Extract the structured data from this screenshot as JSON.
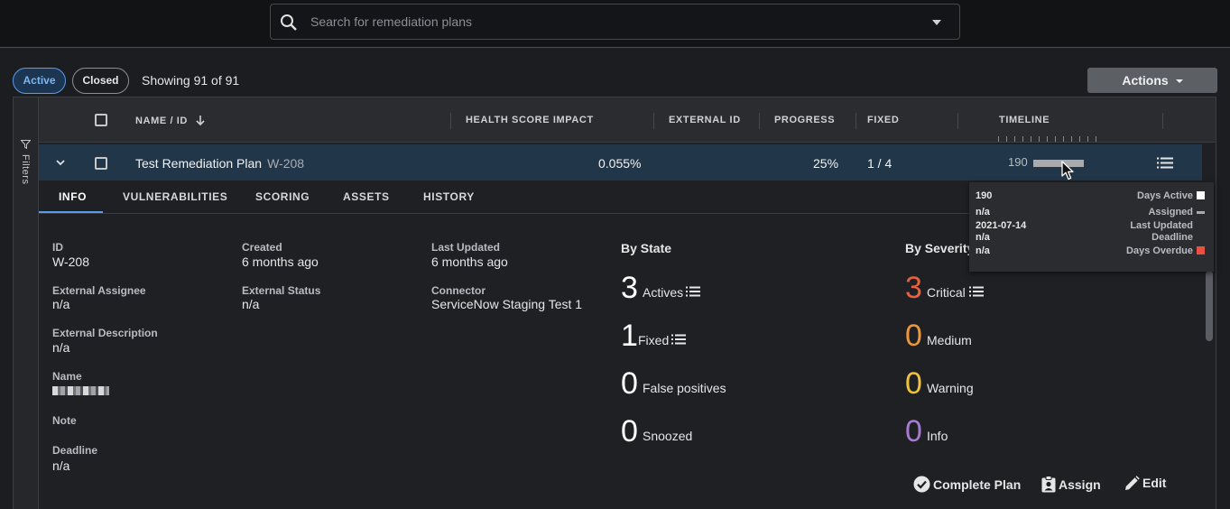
{
  "search": {
    "placeholder": "Search for remediation plans"
  },
  "filters": {
    "active_label": "Active",
    "closed_label": "Closed",
    "showing": "Showing 91 of 91",
    "rail_label": "Filters"
  },
  "toolbar": {
    "actions_label": "Actions"
  },
  "table": {
    "columns": [
      "NAME / ID",
      "HEALTH SCORE IMPACT",
      "EXTERNAL ID",
      "PROGRESS",
      "FIXED",
      "TIMELINE"
    ],
    "row": {
      "name": "Test Remediation Plan",
      "id": "W-208",
      "health_score_impact": "0.055%",
      "progress": "25%",
      "fixed": "1 / 4",
      "timeline_days": "190"
    }
  },
  "tabs": [
    "INFO",
    "VULNERABILITIES",
    "SCORING",
    "ASSETS",
    "HISTORY"
  ],
  "info": {
    "id_label": "ID",
    "id_value": "W-208",
    "created_label": "Created",
    "created_value": "6 months ago",
    "updated_label": "Last Updated",
    "updated_value": "6 months ago",
    "ext_assignee_label": "External Assignee",
    "ext_assignee_value": "n/a",
    "ext_status_label": "External Status",
    "ext_status_value": "n/a",
    "connector_label": "Connector",
    "connector_value": "ServiceNow Staging Test 1",
    "ext_desc_label": "External Description",
    "ext_desc_value": "n/a",
    "name_label": "Name",
    "note_label": "Note",
    "deadline_label": "Deadline",
    "deadline_value": "n/a"
  },
  "by_state": {
    "title": "By State",
    "items": [
      {
        "count": "3",
        "label": "Actives"
      },
      {
        "count": "1",
        "label": "Fixed"
      },
      {
        "count": "0",
        "label": "False positives"
      },
      {
        "count": "0",
        "label": "Snoozed"
      }
    ]
  },
  "by_severity": {
    "title": "By Severity",
    "items": [
      {
        "count": "3",
        "label": "Critical",
        "color": "#e8613f"
      },
      {
        "count": "0",
        "label": "Medium",
        "color": "#f0963a"
      },
      {
        "count": "0",
        "label": "Warning",
        "color": "#f0c23a"
      },
      {
        "count": "0",
        "label": "Info",
        "color": "#a77bd1"
      }
    ]
  },
  "plan_actions": {
    "complete": "Complete Plan",
    "assign": "Assign",
    "edit": "Edit"
  },
  "tooltip": {
    "rows": [
      {
        "value": "190",
        "label": "Days Active"
      },
      {
        "value": "n/a",
        "label": "Assigned"
      },
      {
        "value": "2021-07-14",
        "label": "Last Updated"
      },
      {
        "value": "n/a",
        "label": "Deadline"
      },
      {
        "value": "n/a",
        "label": "Days Overdue"
      }
    ],
    "colors": {
      "days_active": "#ffffff",
      "assigned": "#a8aaad",
      "days_overdue": "#e8513f"
    }
  }
}
